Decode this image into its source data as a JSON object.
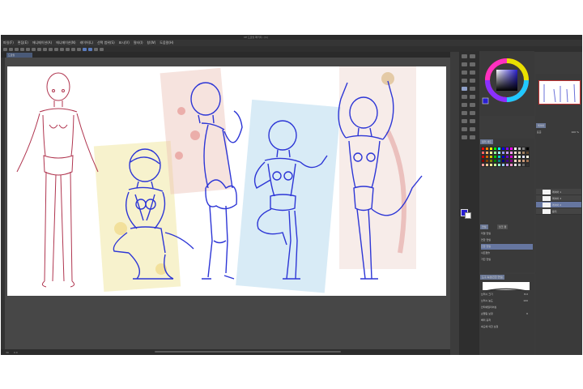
{
  "window": {
    "title": "CE 드로잉 패키지 - [1]"
  },
  "menu": [
    "파일(F)",
    "편집(E)",
    "애니메이션(A)",
    "애니메이션(N)",
    "레이어(L)",
    "선택 범위(S)",
    "표시(V)",
    "필터(I)",
    "창(W)",
    "도움말(H)"
  ],
  "document": {
    "tab": "드로잉"
  },
  "status": {
    "zoom": "30",
    "angle": "0.0"
  },
  "colorset": {
    "header": "컬러 세트"
  },
  "subtool": {
    "tabs": [
      "연필",
      "잉크 펜"
    ],
    "items": [
      "리얼 연필",
      "연한 연필",
      "진한 연필",
      "샤프펜슬",
      "거친 연필"
    ]
  },
  "toolprop": {
    "header": "도구 속성[진한 연필]",
    "brush_size_label": "브러시 크기",
    "brush_size": "8.0",
    "opacity_label": "브러시 농도",
    "opacity": "100",
    "aa_label": "안티에일리어싱",
    "stabilization_label": "손떨림 보정",
    "stabilization": "6",
    "mode_label": "벡터 흡착",
    "speed_label": "속도에 의한 보정"
  },
  "layers": {
    "header": "레이어",
    "mode": "표준",
    "opacity": "100 %",
    "items": [
      {
        "name": "레이어 1"
      },
      {
        "name": "레이어 3"
      },
      {
        "name": "레이어 2"
      },
      {
        "name": "용지"
      }
    ]
  },
  "colors": {
    "main": "#2a1fd0",
    "accent": "#6b7896",
    "sketch_blue": "#2d36d6",
    "sketch_red": "#b0354f"
  },
  "palette": [
    "#ff0000",
    "#ff7f00",
    "#ffff00",
    "#00ff00",
    "#00ffff",
    "#0000ff",
    "#8000ff",
    "#ff00ff",
    "#ffffff",
    "#c0c0c0",
    "#808080",
    "#000000",
    "#ff6666",
    "#ffb266",
    "#ffff99",
    "#99ff99",
    "#99ffff",
    "#9999ff",
    "#cc99ff",
    "#ff99ff",
    "#f0e0d0",
    "#d8c0a8",
    "#a08060",
    "#604830",
    "#cc0000",
    "#cc6600",
    "#cccc00",
    "#00cc00",
    "#00cccc",
    "#0000cc",
    "#6600cc",
    "#cc00cc",
    "#ffe0e0",
    "#e0ffe0",
    "#e0e0ff",
    "#fffbe0",
    "#800000",
    "#804000",
    "#808000",
    "#008000",
    "#008080",
    "#000080",
    "#400080",
    "#800080",
    "#f8d8c8",
    "#e8b898",
    "#c89878",
    "#a07050",
    "#ff9999",
    "#ffcc99",
    "#ffee99",
    "#ccff99",
    "#99ffcc",
    "#99ccff",
    "#cc99ff",
    "#ff99cc",
    "#e6e6e6",
    "#b3b3b3",
    "#666666",
    "#333333"
  ]
}
